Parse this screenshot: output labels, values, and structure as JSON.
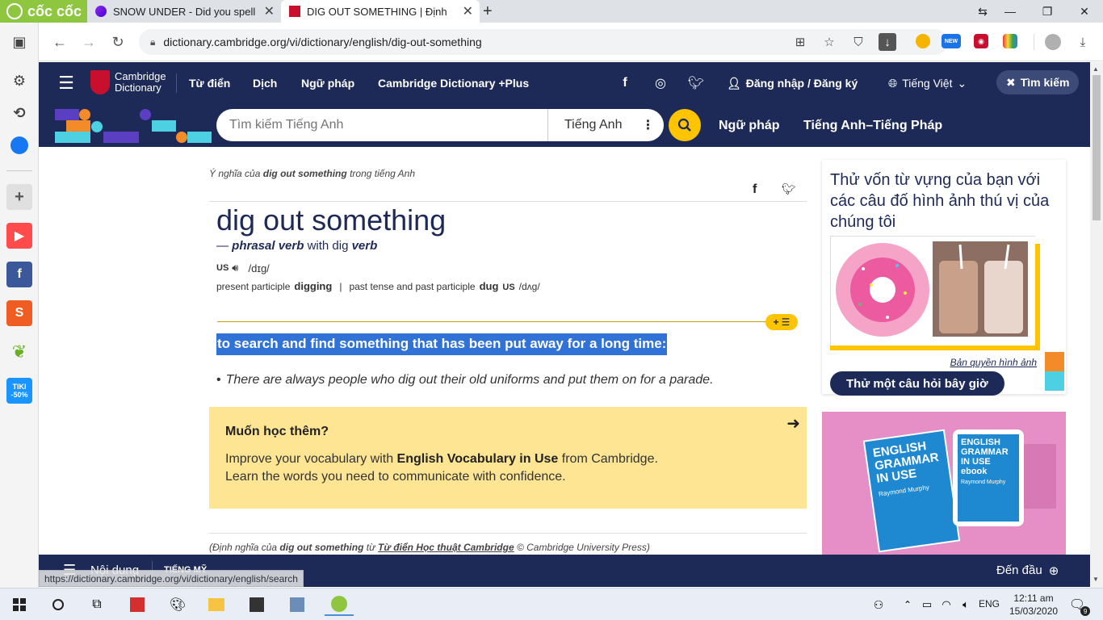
{
  "browser": {
    "brand": "cốc cốc",
    "tabs": [
      {
        "title": "SNOW UNDER - Did you spell"
      },
      {
        "title": "DIG OUT SOMETHING | Định"
      }
    ],
    "new_tab": "+",
    "url": "dictionary.cambridge.org/vi/dictionary/english/dig-out-something",
    "status_url": "https://dictionary.cambridge.org/vi/dictionary/english/search"
  },
  "sidebar": {
    "items": [
      {
        "icon": "panel-icon"
      },
      {
        "icon": "gear-icon"
      },
      {
        "icon": "history-icon"
      },
      {
        "icon": "messenger-icon"
      },
      {
        "icon": "plus-icon"
      },
      {
        "icon": "youtube-icon"
      },
      {
        "icon": "facebook-icon"
      },
      {
        "icon": "shopee-icon"
      },
      {
        "icon": "leaf-icon"
      },
      {
        "icon": "tiki-icon",
        "label": "TIKI -50%"
      }
    ]
  },
  "header": {
    "logo_line1": "Cambridge",
    "logo_line2": "Dictionary",
    "nav": [
      "Từ điển",
      "Dịch",
      "Ngữ pháp",
      "Cambridge Dictionary +Plus"
    ],
    "login": "Đăng nhập / Đăng ký",
    "language": "Tiếng Việt",
    "search_toggle": "Tìm kiếm"
  },
  "searchbar": {
    "placeholder": "Tìm kiếm Tiếng Anh",
    "lang": "Tiếng Anh",
    "links": [
      "Ngữ pháp",
      "Tiếng Anh–Tiếng Pháp"
    ]
  },
  "entry": {
    "meaning_prefix": "Ý nghĩa của",
    "meaning_word": "dig out something",
    "meaning_suffix": "trong tiếng Anh",
    "headword": "dig out something",
    "pos_dash": "—",
    "pos": "phrasal verb",
    "pos_with": "with dig",
    "pos_verb": "verb",
    "region": "US",
    "pron": "/dɪɡ/",
    "pp_label": "present participle",
    "pp_value": "digging",
    "sep": "|",
    "pt_label": "past tense and past participle",
    "pt_value": "dug",
    "pt_region": "US",
    "pt_pron": "/dʌɡ/",
    "definition": "to search and find something that has been put away for a long time:",
    "example": "There are always people who dig out their old uniforms and put them on for a parade.",
    "plus_button": "+"
  },
  "learn_more": {
    "title": "Muốn học thêm?",
    "text1_pre": "Improve your vocabulary with",
    "text1_bold": "English Vocabulary in Use",
    "text1_post": "from Cambridge.",
    "text2": "Learn the words you need to communicate with confidence."
  },
  "citation": {
    "pre": "(Định nghĩa của",
    "word": "dig out something",
    "mid": "từ",
    "link": "Từ điển Học thuật Cambridge",
    "post": "© Cambridge University Press)"
  },
  "promo": {
    "title": "Thử vốn từ vựng của bạn với các câu đố hình ảnh thú vị của chúng tôi",
    "credit": "Bản quyền hình ảnh",
    "button": "Thử một câu hỏi bây giờ"
  },
  "ad": {
    "book1_title": "ENGLISH GRAMMAR IN USE",
    "book1_author": "Raymond Murphy",
    "book2_title": "ENGLISH GRAMMAR IN USE ebook",
    "book2_author": "Raymond Murphy"
  },
  "bottom_nav": {
    "contents": "Nội dung",
    "region": "TIẾNG MỸ",
    "to_top": "Đến đầu"
  },
  "taskbar": {
    "lang": "ENG",
    "time": "12:11 am",
    "date": "15/03/2020",
    "notifications": "9"
  },
  "colors": {
    "cambridge_navy": "#1d2a57",
    "highlight": "#3072d6",
    "yellow": "#fec400",
    "coccoc_green": "#8ec63f"
  }
}
